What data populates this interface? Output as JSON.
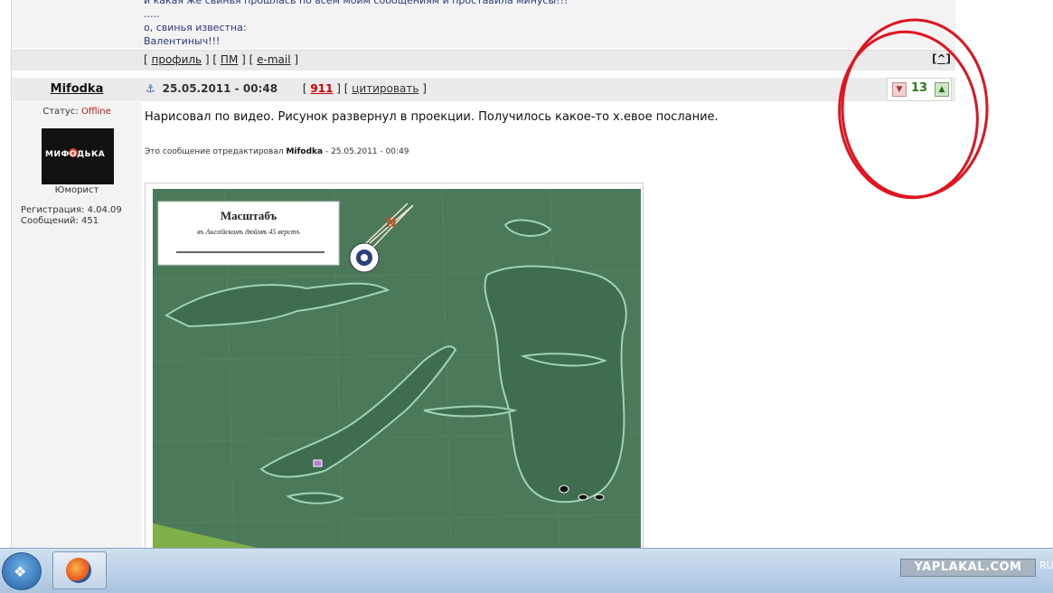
{
  "previous_post": {
    "lines": [
      "и какая же свинья прошлась по всем моим сообщениям и проставила минусы!!!",
      ".....",
      "о, свинья известна:",
      "Валентиныч!!!"
    ],
    "links": {
      "open1": "[ ",
      "profile": "профиль",
      "sep1": " ] [ ",
      "pm": "ПМ",
      "sep2": " ] [ ",
      "email": "e-mail",
      "close": " ]"
    },
    "top_button": "[^]"
  },
  "post": {
    "author": "Mifodka",
    "status_label": "Статус: ",
    "status_value": "Offline",
    "avatar_text": "МИФОДЬКА",
    "rank": "Юморист",
    "registration": "Регистрация: 4.04.09",
    "messages": "Сообщений: 451",
    "anchor_glyph": "⚓",
    "date": "25.05.2011 - 00:48",
    "bracket_open": "[ ",
    "number": "911",
    "bracket_mid": " ] [ ",
    "quote_label": "цитировать",
    "bracket_close": " ]",
    "rating_value": "13",
    "text": "Нарисовал по видео. Рисунок развернул в проекции. Получилось какое-то х.евое послание.",
    "edited_prefix": "Это сообщение отредактировал ",
    "edited_author": "Mifodka",
    "edited_date": " - 25.05.2011 - 00:49",
    "map": {
      "title": "Масштабъ",
      "subtitle": "въ Англійскомъ дюймѣ 45 верстъ"
    }
  },
  "taskbar": {
    "brand": "YAPLAKAL.COM",
    "lang": "RU"
  },
  "colors": {
    "map_green": "#4a7a5a",
    "annotation_red": "#e0141e",
    "offline_red": "#b31b1b",
    "rating_green": "#2b7a1c"
  }
}
